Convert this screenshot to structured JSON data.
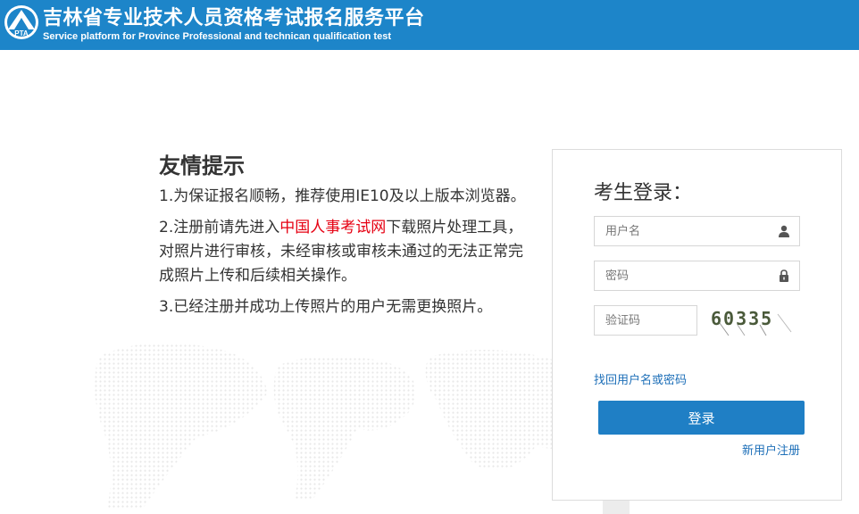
{
  "header": {
    "title_cn": "吉林省专业技术人员资格考试报名服务平台",
    "title_en": "Service platform for Province Professional and technican qualification test",
    "logo_text": "PTA",
    "background_color": "#1d85c9"
  },
  "tips": {
    "title": "友情提示",
    "item1": "1.为保证报名顺畅，推荐使用IE10及以上版本浏览器。",
    "item2_before": "2.注册前请先进入",
    "item2_link": "中国人事考试网",
    "item2_after": "下载照片处理工具，对照片进行审核，未经审核或审核未通过的无法正常完成照片上传和后续相关操作。",
    "item3": "3.已经注册并成功上传照片的用户无需更换照片。"
  },
  "login": {
    "title": "考生登录：",
    "username_placeholder": "用户名",
    "password_placeholder": "密码",
    "captcha_placeholder": "验证码",
    "captcha_text": "60335",
    "forgot_link": "找回用户名或密码",
    "login_button": "登录",
    "register_link": "新用户注册",
    "button_color": "#1f7fc5"
  },
  "icons": {
    "username": "user-icon",
    "password": "lock-icon"
  }
}
